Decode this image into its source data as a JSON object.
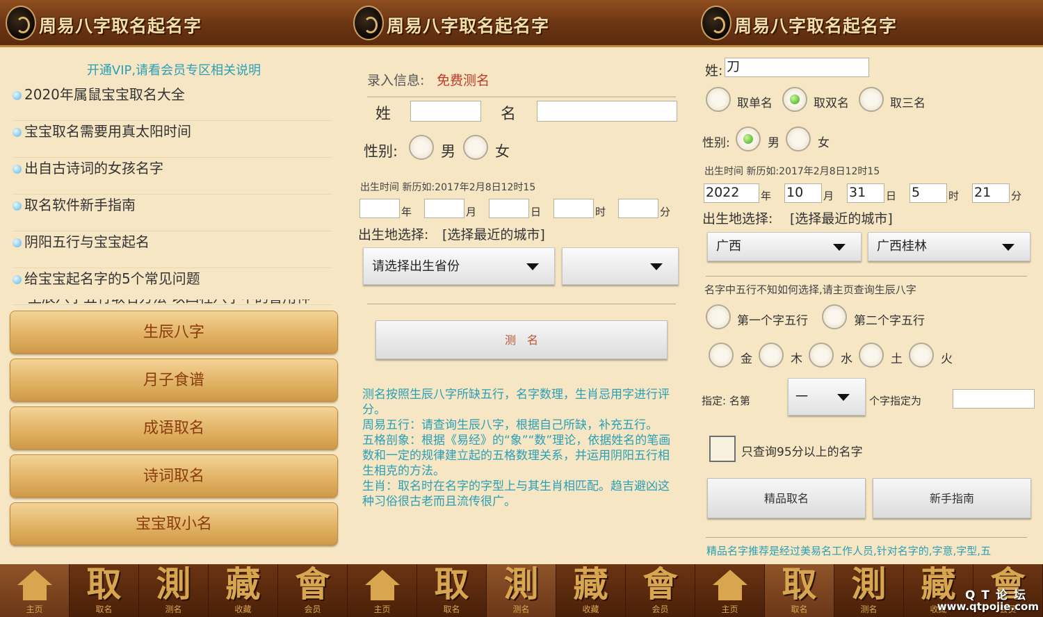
{
  "app": {
    "title": "周易八字取名起名字"
  },
  "nav": [
    {
      "glyph": "",
      "label": "主页"
    },
    {
      "glyph": "取",
      "label": "取名"
    },
    {
      "glyph": "測",
      "label": "测名"
    },
    {
      "glyph": "藏",
      "label": "收藏"
    },
    {
      "glyph": "會",
      "label": "会员"
    }
  ],
  "panel1": {
    "vip_notice": "开通VIP,请看会员专区相关说明",
    "articles": [
      "2020年属鼠宝宝取名大全",
      "宝宝取名需要用真太阳时间",
      "出自古诗词的女孩名字",
      "取名软件新手指南",
      "阴阳五行与宝宝起名",
      "给宝宝起名字的5个常见问题",
      "生辰八字五行取名方法 以四柱八字中的喜用神"
    ],
    "menu": [
      "生辰八字",
      "月子食谱",
      "成语取名",
      "诗词取名",
      "宝宝取小名"
    ]
  },
  "panel2": {
    "info_label": "录入信息:",
    "info_value": "免费测名",
    "surname_label": "姓",
    "name_label": "名",
    "gender_label": "性别:",
    "male": "男",
    "female": "女",
    "birth_hint": "出生时间 新历如:2017年2月8日12时15",
    "units": [
      "年",
      "月",
      "日",
      "时",
      "分"
    ],
    "birthplace_label": "出生地选择:",
    "birthplace_link": "[选择最近的城市]",
    "province_placeholder": "请选择出生省份",
    "city_value": "",
    "test_button": "测　名",
    "desc": [
      "测名按照生辰八字所缺五行，名字数理，生肖忌用字进行评分。",
      "周易五行：请查询生辰八字，根据自己所缺，补充五行。",
      "五格剖象：根据《易经》的“象”“数”理论，依据姓名的笔画数和一定的规律建立起的五格数理关系，并运用阴阳五行相生相克的方法。",
      "生肖：取名时在名字的字型上与其生肖相匹配。趋吉避凶这种习俗很古老而且流传很广。"
    ]
  },
  "panel3": {
    "surname_label": "姓:",
    "surname_value": "刀",
    "name_types": [
      "取单名",
      "取双名",
      "取三名"
    ],
    "gender_label": "性别:",
    "male": "男",
    "female": "女",
    "birth_hint": "出生时间 新历如:2017年2月8日12时15",
    "birth_values": [
      "2022",
      "10",
      "31",
      "5",
      "21"
    ],
    "units": [
      "年",
      "月",
      "日",
      "时",
      "分"
    ],
    "birthplace_label": "出生地选择:",
    "birthplace_link": "[选择最近的城市]",
    "province": "广西",
    "city": "广西桂林",
    "wuxing_hint": "名字中五行不知如何选择,请主页查询生辰八字",
    "wuxing_pos": [
      "第一个字五行",
      "第二个字五行"
    ],
    "elements": [
      "金",
      "木",
      "水",
      "土",
      "火"
    ],
    "assign_label": "指定: 名第",
    "assign_value": "一",
    "assign_suffix": "个字指定为",
    "only95": "只查询95分以上的名字",
    "premium_button": "精品取名",
    "guide_button": "新手指南",
    "footer_text": "精品名字推荐是经过美易名工作人员,针对名字的,字意,字型,五"
  },
  "watermark": {
    "line1": "QT论坛",
    "line2": "www.qtpojie.com"
  }
}
